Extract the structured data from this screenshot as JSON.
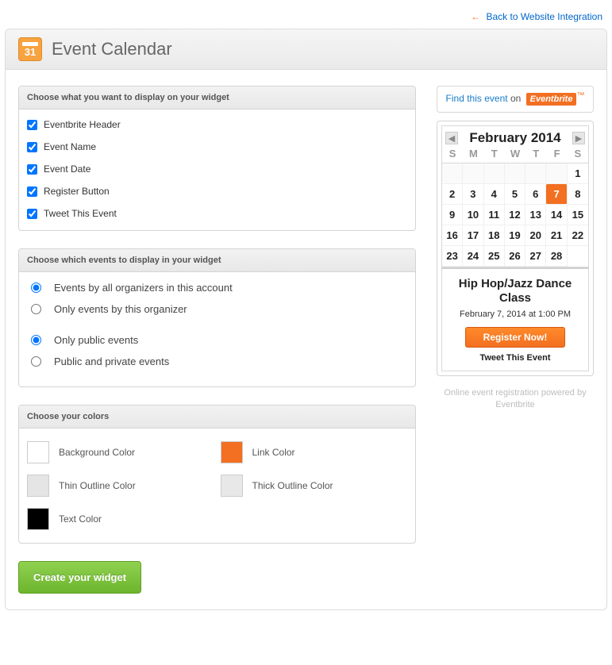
{
  "back_link": {
    "arrow": "←",
    "label": "Back to Website Integration"
  },
  "header": {
    "icon_day": "31",
    "title": "Event Calendar"
  },
  "section1": {
    "title": "Choose what you want to display on your widget",
    "options": [
      {
        "label": "Eventbrite Header",
        "checked": true
      },
      {
        "label": "Event Name",
        "checked": true
      },
      {
        "label": "Event Date",
        "checked": true
      },
      {
        "label": "Register Button",
        "checked": true
      },
      {
        "label": "Tweet This Event",
        "checked": true
      }
    ]
  },
  "section2": {
    "title": "Choose which events to display in your widget",
    "group1": [
      {
        "label": "Events by all organizers in this account",
        "checked": true
      },
      {
        "label": "Only events by this organizer",
        "checked": false
      }
    ],
    "group2": [
      {
        "label": "Only public events",
        "checked": true
      },
      {
        "label": "Public and private events",
        "checked": false
      }
    ]
  },
  "section3": {
    "title": "Choose your colors",
    "colors": [
      {
        "class": "white",
        "label": "Background Color"
      },
      {
        "class": "orange",
        "label": "Link Color"
      },
      {
        "class": "lgrey",
        "label": "Thin Outline Color"
      },
      {
        "class": "dgrey",
        "label": "Thick Outline Color"
      },
      {
        "class": "black",
        "label": "Text Color"
      }
    ]
  },
  "create_button": "Create your widget",
  "find_event": {
    "link": "Find this event",
    "on": "on",
    "brand": "Eventbrite",
    "tm": "™"
  },
  "calendar": {
    "title": "February 2014",
    "dow": [
      "S",
      "M",
      "T",
      "W",
      "T",
      "F",
      "S"
    ],
    "leading_empty": 6,
    "days": 28,
    "selected": 7
  },
  "event": {
    "title": "Hip Hop/Jazz Dance Class",
    "date": "February 7, 2014 at 1:00 PM",
    "register": "Register Now!",
    "tweet": "Tweet This Event"
  },
  "footer": "Online event registration powered by Eventbrite"
}
